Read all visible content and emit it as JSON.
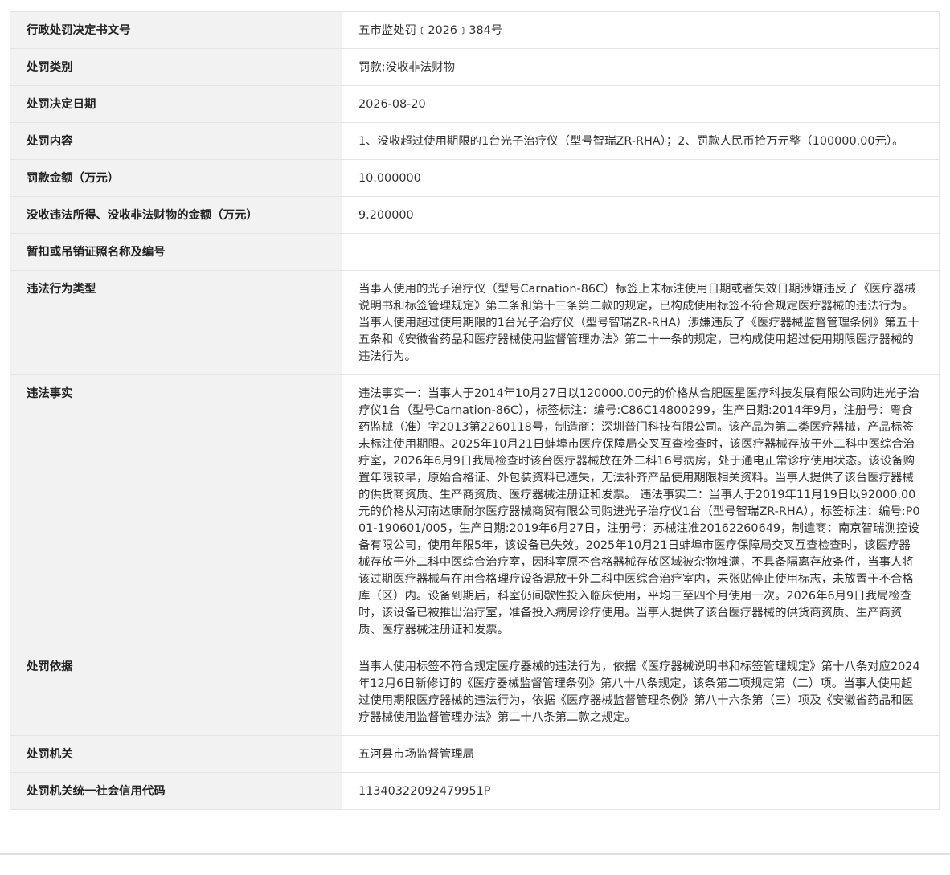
{
  "rows": [
    {
      "label": "行政处罚决定书文号",
      "value": "五市监处罚﹝2026﹞384号"
    },
    {
      "label": "处罚类别",
      "value": "罚款;没收非法财物"
    },
    {
      "label": "处罚决定日期",
      "value": "2026-08-20"
    },
    {
      "label": "处罚内容",
      "value": "1、没收超过使用期限的1台光子治疗仪（型号智瑞ZR-RHA）；2、罚款人民币拾万元整（100000.00元）。"
    },
    {
      "label": "罚款金额（万元）",
      "value": "10.000000"
    },
    {
      "label": "没收违法所得、没收非法财物的金额（万元）",
      "value": "9.200000"
    },
    {
      "label": "暂扣或吊销证照名称及编号",
      "value": ""
    },
    {
      "label": "违法行为类型",
      "value": "当事人使用的光子治疗仪（型号Carnation-86C）标签上未标注使用日期或者失效日期涉嫌违反了《医疗器械说明书和标签管理规定》第二条和第十三条第二款的规定，已构成使用标签不符合规定医疗器械的违法行为。 当事人使用超过使用期限的1台光子治疗仪（型号智瑞ZR-RHA）涉嫌违反了《医疗器械监督管理条例》第五十五条和《安徽省药品和医疗器械使用监督管理办法》第二十一条的规定，已构成使用超过使用期限医疗器械的违法行为。"
    },
    {
      "label": "违法事实",
      "value": "违法事实一：当事人于2014年10月27日以120000.00元的价格从合肥医星医疗科技发展有限公司购进光子治疗仪1台（型号Carnation-86C），标签标注：编号:C86C14800299，生产日期:2014年9月，注册号：粤食药监械（准）字2013第2260118号，制造商：深圳普门科技有限公司。该产品为第二类医疗器械，产品标签未标注使用期限。2025年10月21日蚌埠市医疗保障局交叉互查检查时，该医疗器械存放于外二科中医综合治疗室，2026年6月9日我局检查时该台医疗器械放在外二科16号病房，处于通电正常诊疗使用状态。该设备购置年限较早，原始合格证、外包装资料已遗失，无法补齐产品使用期限相关资料。当事人提供了该台医疗器械的供货商资质、生产商资质、医疗器械注册证和发票。 违法事实二：当事人于2019年11月19日以92000.00元的价格从河南达康耐尔医疗器械商贸有限公司购进光子治疗仪1台（型号智瑞ZR-RHA），标签标注：编号:P001-190601/005，生产日期:2019年6月27日，注册号：苏械注准20162260649，制造商：南京智瑞测控设备有限公司，使用年限5年，该设备已失效。2025年10月21日蚌埠市医疗保障局交叉互查检查时，该医疗器械存放于外二科中医综合治疗室，因科室原不合格器械存放区域被杂物堆满，不具备隔离存放条件，当事人将该过期医疗器械与在用合格理疗设备混放于外二科中医综合治疗室内，未张贴停止使用标志，未放置于不合格库（区）内。设备到期后，科室仍间歇性投入临床使用，平均三至四个月使用一次。2026年6月9日我局检查时，该设备已被推出治疗室，准备投入病房诊疗使用。当事人提供了该台医疗器械的供货商资质、生产商资质、医疗器械注册证和发票。"
    },
    {
      "label": "处罚依据",
      "value": "当事人使用标签不符合规定医疗器械的违法行为，依据《医疗器械说明书和标签管理规定》第十八条对应2024年12月6日新修订的《医疗器械监督管理条例》第八十八条规定，该条第二项规定第（二）项。当事人使用超过使用期限医疗器械的违法行为，依据《医疗器械监督管理条例》第八十六条第（三）项及《安徽省药品和医疗器械使用监督管理办法》第二十八条第二款之规定。"
    },
    {
      "label": "处罚机关",
      "value": "五河县市场监督管理局"
    },
    {
      "label": "处罚机关统一社会信用代码",
      "value": "11340322092479951P"
    }
  ]
}
